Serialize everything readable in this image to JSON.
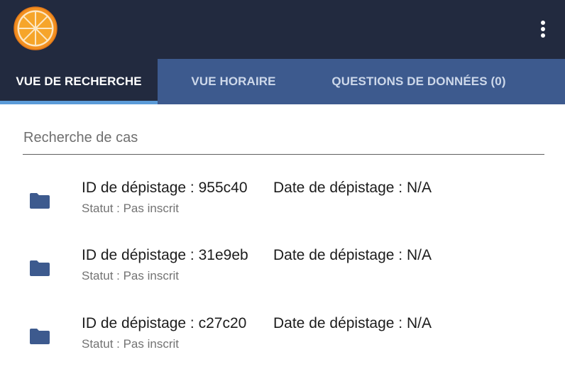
{
  "app": {
    "logo": "orange-slice-logo",
    "menu_icon": "more-vertical-icon"
  },
  "tabs": [
    {
      "label": "VUE DE RECHERCHE",
      "active": true
    },
    {
      "label": "VUE HORAIRE",
      "active": false
    },
    {
      "label": "QUESTIONS DE DONNÉES (0)",
      "active": false
    }
  ],
  "search": {
    "placeholder": "Recherche de cas",
    "value": ""
  },
  "cases": [
    {
      "icon": "folder-icon",
      "id_text": "ID de dépistage : 955c40",
      "date_text": "Date de dépistage : N/A",
      "status_text": "Statut : Pas inscrit"
    },
    {
      "icon": "folder-icon",
      "id_text": "ID de dépistage : 31e9eb",
      "date_text": "Date de dépistage : N/A",
      "status_text": "Statut : Pas inscrit"
    },
    {
      "icon": "folder-icon",
      "id_text": "ID de dépistage : c27c20",
      "date_text": "Date de dépistage : N/A",
      "status_text": "Statut : Pas inscrit"
    }
  ],
  "colors": {
    "header_bg": "#222a3f",
    "tabbar_bg": "#3d5a8e",
    "tab_indicator": "#5b9bd8",
    "folder": "#3d5a8e",
    "logo_orange": "#f7931e"
  }
}
